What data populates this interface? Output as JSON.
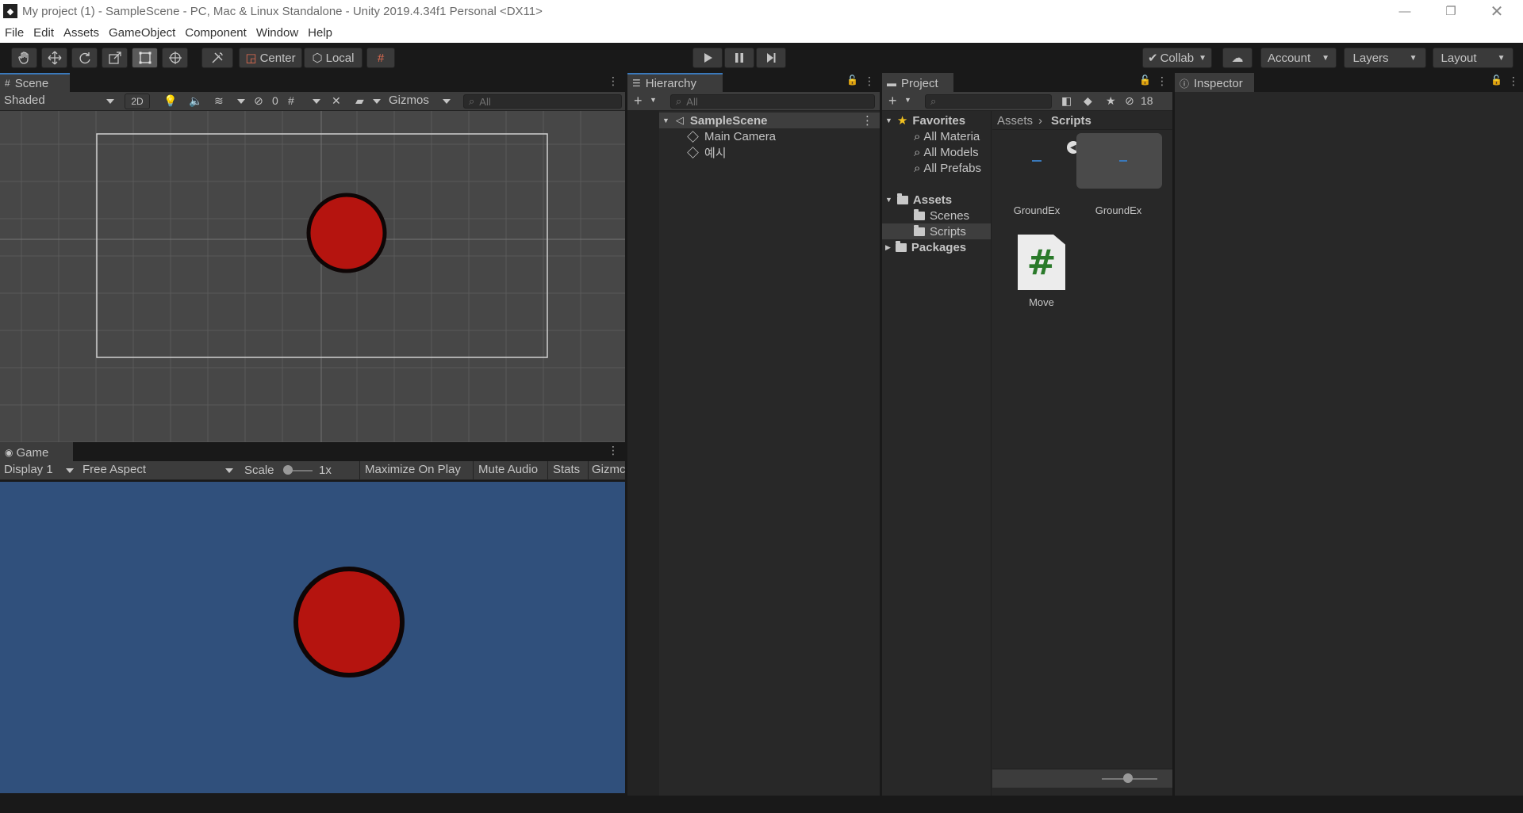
{
  "window": {
    "title": "My project (1) - SampleScene - PC, Mac & Linux Standalone - Unity 2019.4.34f1 Personal <DX11>"
  },
  "menu": [
    "File",
    "Edit",
    "Assets",
    "GameObject",
    "Component",
    "Window",
    "Help"
  ],
  "toolbar": {
    "pivot": "Center",
    "space": "Local",
    "collab": "Collab",
    "account": "Account",
    "layers": "Layers",
    "layout": "Layout"
  },
  "scene": {
    "tab": "Scene",
    "shading": "Shaded",
    "mode2d": "2D",
    "hidden_count": "0",
    "gizmos": "Gizmos",
    "search_placeholder": "All"
  },
  "game": {
    "tab": "Game",
    "display": "Display 1",
    "aspect": "Free Aspect",
    "scale_label": "Scale",
    "scale_value": "1x",
    "maximize": "Maximize On Play",
    "mute": "Mute Audio",
    "stats": "Stats",
    "gizmos": "Gizmc",
    "background": "#30507c"
  },
  "hierarchy": {
    "tab": "Hierarchy",
    "search_placeholder": "All",
    "scene_name": "SampleScene",
    "objects": [
      "Main Camera",
      "예시"
    ]
  },
  "project": {
    "tab": "Project",
    "hidden_count": "18",
    "favorites_label": "Favorites",
    "favorites": [
      "All Materia",
      "All Models",
      "All Prefabs"
    ],
    "assets_label": "Assets",
    "asset_folders": [
      "Scenes",
      "Scripts"
    ],
    "packages_label": "Packages",
    "breadcrumb": [
      "Assets",
      "Scripts"
    ],
    "items": [
      "GroundEx",
      "GroundEx",
      "Move"
    ]
  },
  "inspector": {
    "tab": "Inspector"
  },
  "colors": {
    "ball": "#b5140f",
    "ball_outline": "#0e0606",
    "accent": "#3a79bb"
  }
}
